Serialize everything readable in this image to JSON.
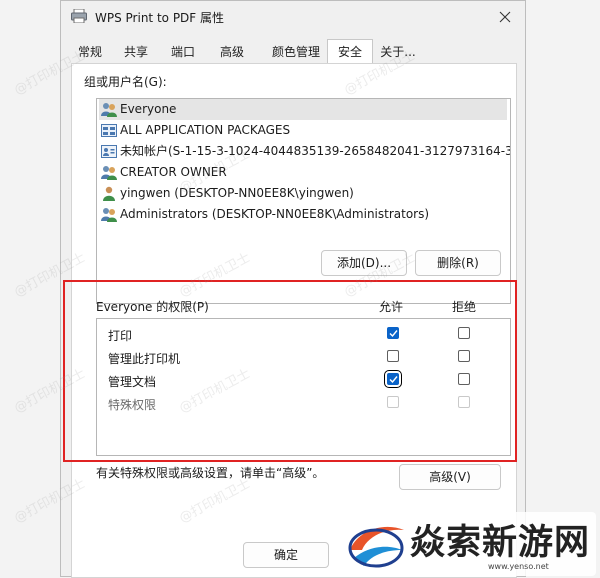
{
  "window": {
    "title": "WPS Print to PDF 属性"
  },
  "tabs": [
    {
      "label": "常规"
    },
    {
      "label": "共享"
    },
    {
      "label": "端口"
    },
    {
      "label": "高级"
    },
    {
      "label": "颜色管理"
    },
    {
      "label": "安全"
    },
    {
      "label": "关于..."
    }
  ],
  "active_tab": "安全",
  "group_list": {
    "label": "组或用户名(G):",
    "items": [
      {
        "name": "Everyone",
        "icon": "users-group-icon",
        "selected": true
      },
      {
        "name": "ALL APPLICATION PACKAGES",
        "icon": "app-packages-icon",
        "selected": false
      },
      {
        "name": "未知帐户(S-1-15-3-1024-4044835139-2658482041-3127973164-32...",
        "icon": "unknown-account-icon",
        "selected": false
      },
      {
        "name": "CREATOR OWNER",
        "icon": "users-group-icon",
        "selected": false
      },
      {
        "name": "yingwen (DESKTOP-NN0EE8K\\yingwen)",
        "icon": "user-icon",
        "selected": false
      },
      {
        "name": "Administrators (DESKTOP-NN0EE8K\\Administrators)",
        "icon": "users-group-icon",
        "selected": false
      }
    ]
  },
  "buttons": {
    "add": "添加(D)...",
    "remove": "删除(R)",
    "advanced": "高级(V)",
    "ok": "确定"
  },
  "permissions": {
    "title": "Everyone 的权限(P)",
    "allow_header": "允许",
    "deny_header": "拒绝",
    "rows": [
      {
        "name": "打印",
        "allow": true,
        "deny": false,
        "disabled": false
      },
      {
        "name": "管理此打印机",
        "allow": false,
        "deny": false,
        "disabled": false
      },
      {
        "name": "管理文档",
        "allow": true,
        "deny": false,
        "disabled": false,
        "focused": true
      },
      {
        "name": "特殊权限",
        "allow": false,
        "deny": false,
        "disabled": true
      }
    ]
  },
  "hint": "有关特殊权限或高级设置，请单击“高级”。",
  "watermark_text": "@打印机卫士",
  "logo": {
    "text": "焱索新游网",
    "url": "www.yenso.net"
  },
  "colors": {
    "accent": "#0a63c8",
    "highlight_box": "#e02323"
  }
}
